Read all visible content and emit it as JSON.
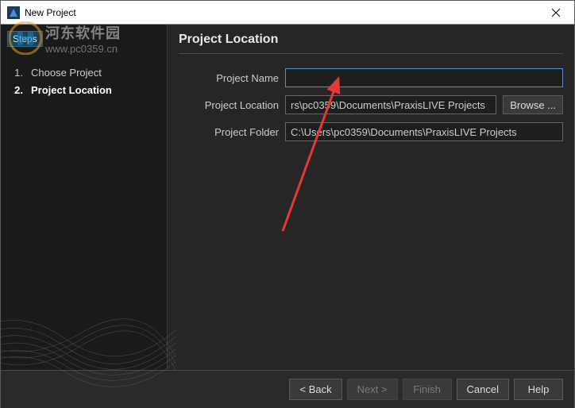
{
  "window": {
    "title": "New Project"
  },
  "sidebar": {
    "steps_label": "Steps",
    "items": [
      {
        "num": "1.",
        "label": "Choose Project"
      },
      {
        "num": "2.",
        "label": "Project Location"
      }
    ],
    "current_index": 1
  },
  "main": {
    "heading": "Project Location",
    "fields": {
      "name_label": "Project Name",
      "name_value": "",
      "location_label": "Project Location",
      "location_value": "rs\\pc0359\\Documents\\PraxisLIVE Projects",
      "folder_label": "Project Folder",
      "folder_value": "C:\\Users\\pc0359\\Documents\\PraxisLIVE Projects",
      "browse_label": "Browse ..."
    }
  },
  "footer": {
    "back": "< Back",
    "next": "Next >",
    "finish": "Finish",
    "cancel": "Cancel",
    "help": "Help"
  },
  "watermark": {
    "cn": "河东软件园",
    "url": "www.pc0359.cn"
  }
}
